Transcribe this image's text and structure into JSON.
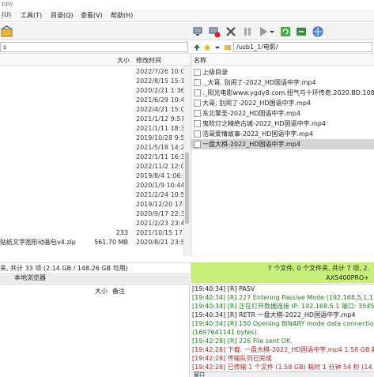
{
  "window": {
    "title_fragment": "ppy"
  },
  "menu": [
    "(U)",
    "工具(T)",
    "目录(Q)",
    "查看(V)",
    "帮助(H)"
  ],
  "colors": {
    "log_green": "#1f7a1f",
    "log_red": "#b41e1e",
    "status_green": "#c6f07a",
    "selected_row": "#d4d4d4"
  },
  "toolbar_right_icons": [
    "disconnect-icon",
    "delete-icon",
    "close-icon",
    "pause-icon",
    "play-icon",
    "dropdown-icon",
    "refresh-icon",
    "sync-icon",
    "globe-icon"
  ],
  "left": {
    "path": "s",
    "headers": {
      "size": "大小",
      "modified": "修改时间"
    },
    "rows": [
      {
        "name": "",
        "size": "",
        "date": "2022/7/26 10:0"
      },
      {
        "name": "",
        "size": "",
        "date": "2022/8/15 15:1"
      },
      {
        "name": "",
        "size": "",
        "date": "2020/2/21 1:36"
      },
      {
        "name": "",
        "size": "",
        "date": "2021/6/29 10:4"
      },
      {
        "name": "",
        "size": "",
        "date": "2022/4/21 15:0"
      },
      {
        "name": "",
        "size": "",
        "date": "2021/1/12 9:57"
      },
      {
        "name": "",
        "size": "",
        "date": "2021/1/11 18:3"
      },
      {
        "name": "",
        "size": "",
        "date": "2019/10/28 9:5"
      },
      {
        "name": "",
        "size": "",
        "date": "2021/5/18 14:2"
      },
      {
        "name": "",
        "size": "",
        "date": "2022/1/11 16:3"
      },
      {
        "name": "",
        "size": "",
        "date": "2022/11/2 12:0"
      },
      {
        "name": "",
        "size": "",
        "date": "2019/8/4 1:06:"
      },
      {
        "name": "",
        "size": "",
        "date": "2020/1/9 10:44"
      },
      {
        "name": "",
        "size": "",
        "date": "2021/2/24 10:5"
      },
      {
        "name": "",
        "size": "",
        "date": "2019/12/20 17"
      },
      {
        "name": "",
        "size": "",
        "date": "2020/9/17 22:3"
      },
      {
        "name": "",
        "size": "",
        "date": "2021/2/23 23:4"
      },
      {
        "name": "",
        "size": "233",
        "date": "2021/10/15 17:"
      },
      {
        "name": "贴纸文字图形动画包v4.zip",
        "size": "561.70 MB",
        "date": "2020/8/21 23:5"
      }
    ],
    "status": "夹, 共计 33 项 (2.14 GB / 148.26 GB 可用)",
    "site_label": "本地浏览器"
  },
  "right": {
    "path": "/usb1_1/电影/",
    "header_name": "名称",
    "rows": [
      {
        "name": "上级目录",
        "icon": "folder-up-icon"
      },
      {
        "name": "._大哥, 别闹了-2022_HD国语中字.mp4",
        "icon": "file-icon"
      },
      {
        "name": "._阳光电影www.ygdy8.com.扭气与十环传奇.2020.BD.1080P.",
        "icon": "file-icon"
      },
      {
        "name": "大哥, 别闹了-2022_HD国语中字.mp4",
        "icon": "file-icon"
      },
      {
        "name": "东北警圣-2022_HD国语中字.mp4",
        "icon": "file-icon"
      },
      {
        "name": "鬼吹灯之精绝古城-2022_HD国语中字.mp4",
        "icon": "file-icon"
      },
      {
        "name": "浩哥爱情故事-2022_HD国语中字.mp4",
        "icon": "file-icon"
      },
      {
        "name": "一盘大棋-2022_HD国语中字.mp4",
        "icon": "file-icon",
        "selected": true
      }
    ],
    "status_line1": "7 个文件, 0 个文件夹, 共计 7 项, 2.",
    "status_line2": "AX5400PRO+"
  },
  "queue": {
    "headers": [
      "大小",
      "备注"
    ]
  },
  "log": [
    {
      "t": "[19:40:34] [R] PASV",
      "c": "c-dark"
    },
    {
      "t": "[19:40:34] [R] 227 Entering Passive Mode (192,168,5,1,138,12",
      "c": "c-green"
    },
    {
      "t": "[19:40:34] [R] 正在打开数据连接 IP: 192.168.5.1 端口: 35453",
      "c": "c-green"
    },
    {
      "t": "[19:40:34] [R] RETR 一盘大棋-2022_HD国语中字.mp4",
      "c": "c-dark"
    },
    {
      "t": "[19:40:34] [R] 150 Opening BINARY mode data connection fo",
      "c": "c-green"
    },
    {
      "t": "(1697641141 bytes).",
      "c": "c-green"
    },
    {
      "t": "[19:42:28] [R] 226 File sent OK.",
      "c": "c-green"
    },
    {
      "t": "[19:42:28] 下载: 一盘大棋-2022_HD国语中字.mp4 1.58 GB 耗时",
      "c": "c-red"
    },
    {
      "t": "[19:42:28] 传输队列已完成",
      "c": "c-red"
    },
    {
      "t": "[19:42:28] 已传输 1 个文件 (1.58 GB) 耗时 1 分钟 54 秒 (14.2",
      "c": "c-red"
    }
  ],
  "bottom_tab": "窗口"
}
